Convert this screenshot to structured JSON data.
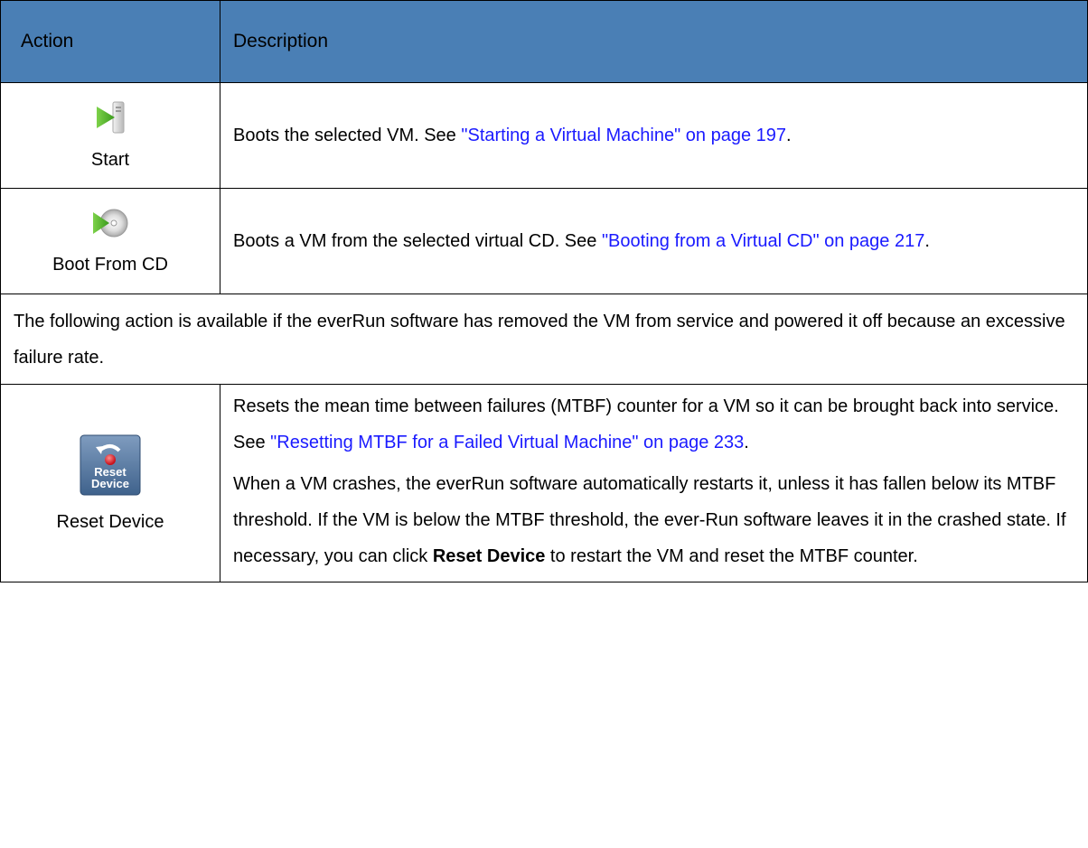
{
  "header": {
    "action": "Action",
    "description": "Description"
  },
  "rows": [
    {
      "label": "Start",
      "icon": "start-icon",
      "text": "Boots the selected VM. See ",
      "link": "\"Starting a Virtual Machine\" on page 197",
      "after": "."
    },
    {
      "label": "Boot From CD",
      "icon": "boot-cd-icon",
      "text": "Boots a VM from the selected virtual CD. See ",
      "link": "\"Booting from a Virtual CD\" on page 217",
      "after": "."
    }
  ],
  "note": "The following action is available if the everRun software has removed the VM from service and powered it off because an excessive failure rate.",
  "reset": {
    "label": "Reset Device",
    "icon": "reset-device-icon",
    "icon_text_1": "Reset",
    "icon_text_2": "Device",
    "p1_text": "Resets the mean time between failures (MTBF) counter for a VM so it can be brought back into service. See ",
    "p1_link": "\"Resetting MTBF for a Failed Virtual Machine\" on page 233",
    "p1_after": ".",
    "p2_text": "When a VM crashes, the everRun software automatically restarts it, unless it has fallen below its MTBF threshold. If the VM is below the MTBF threshold, the ever-Run software leaves it in the crashed state. If necessary, you can click ",
    "p2_bold": "Reset Device",
    "p2_after": " to restart the VM and reset the MTBF counter."
  },
  "colors": {
    "header_bg": "#4a7fb5",
    "link": "#1a1aff"
  }
}
